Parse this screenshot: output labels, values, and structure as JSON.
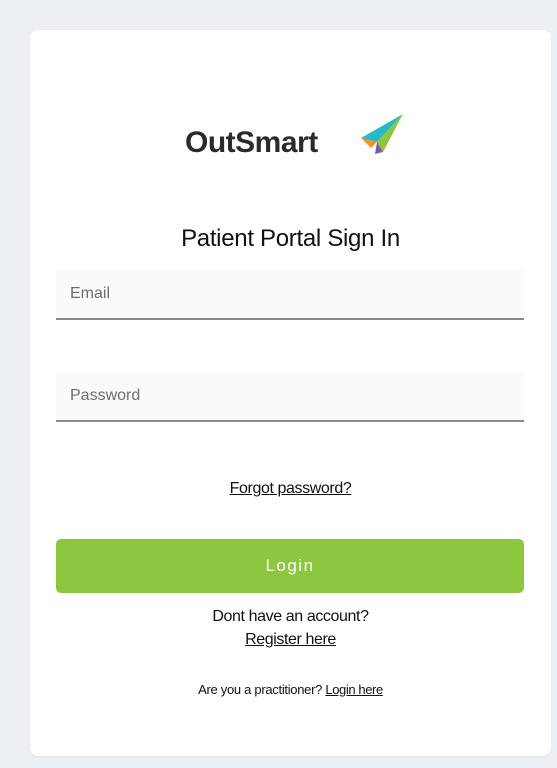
{
  "brand": {
    "name": "OutSmart",
    "logo_icon": "paper-plane-icon",
    "colors": {
      "teal": "#2ab7ca",
      "green": "#8dc63f",
      "orange": "#f7941d",
      "purple": "#7b5ea7"
    }
  },
  "page": {
    "title": "Patient Portal Sign In"
  },
  "form": {
    "email_placeholder": "Email",
    "email_value": "",
    "password_placeholder": "Password",
    "password_value": "",
    "forgot_label": "Forgot password?",
    "login_label": "Login",
    "login_color": "#8dc63f"
  },
  "footer": {
    "no_account_text": "Dont have an account?",
    "register_label": "Register here",
    "practitioner_text": "Are you a practitioner?",
    "practitioner_login_label": "Login here"
  }
}
